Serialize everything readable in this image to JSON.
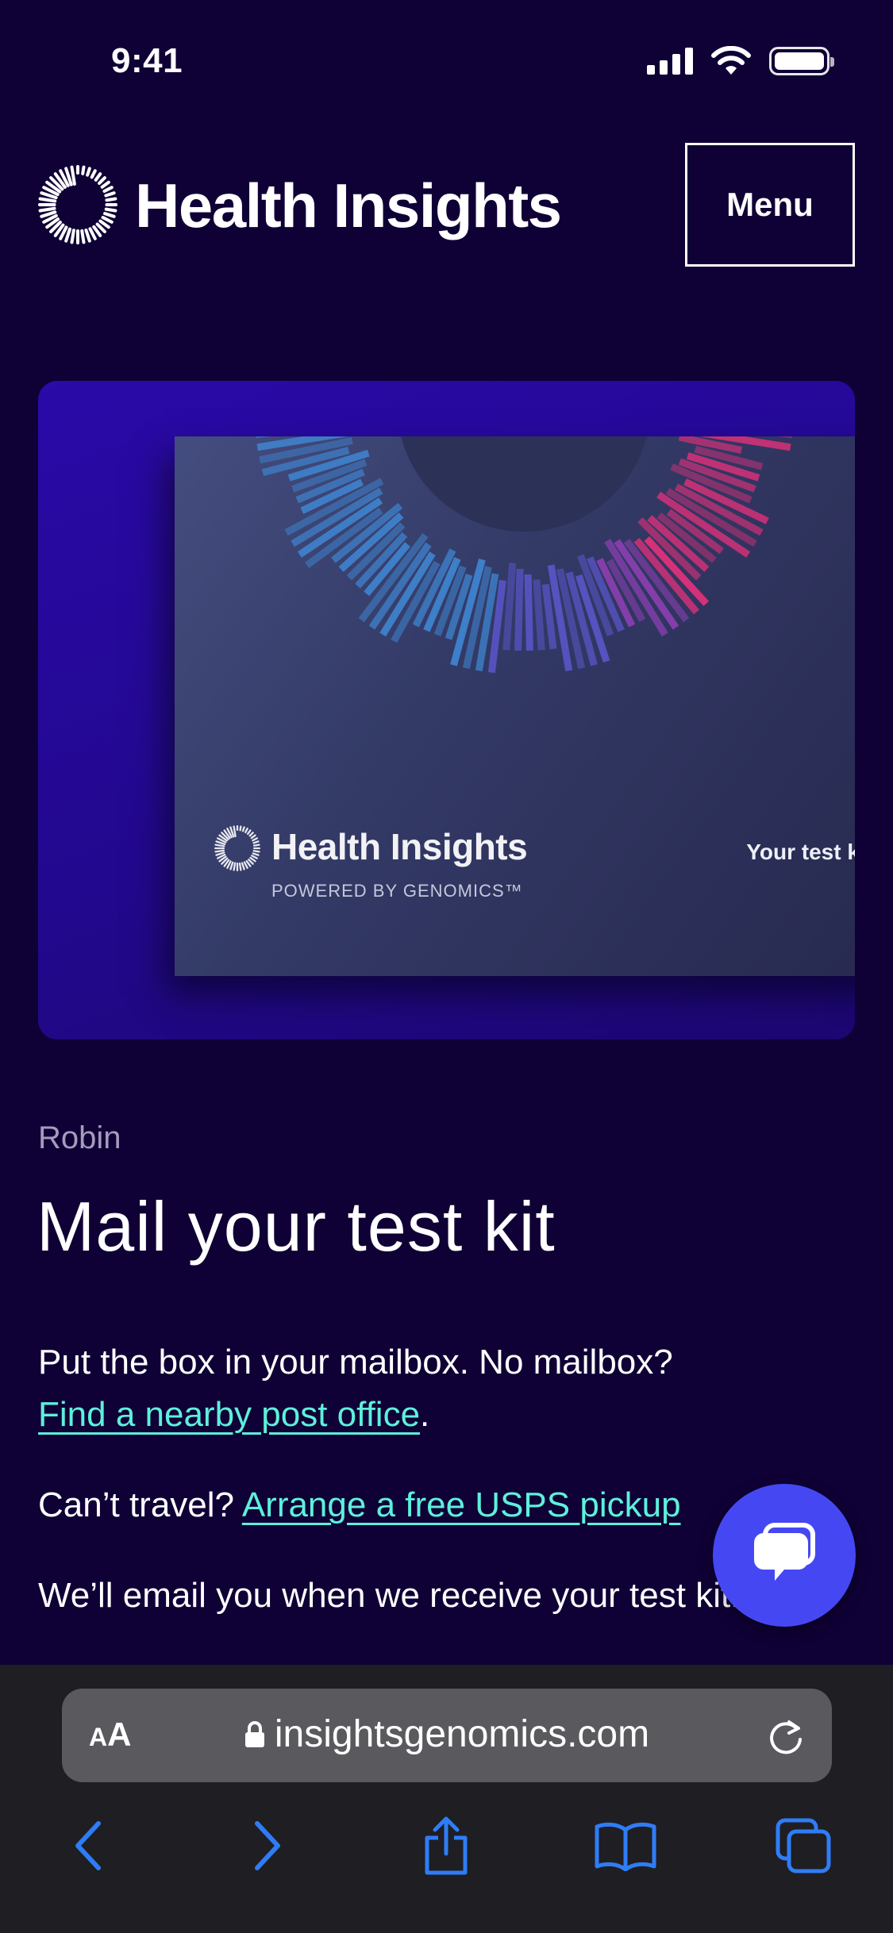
{
  "status_bar": {
    "time": "9:41"
  },
  "header": {
    "brand": "Health Insights",
    "menu_label": "Menu"
  },
  "hero": {
    "kit_brand": "Health Insights",
    "kit_powered": "POWERED BY GENOMICS™",
    "kit_label": "Your test kit"
  },
  "content": {
    "user_name": "Robin",
    "title": "Mail your test kit",
    "p1_text": "Put the box in your mailbox. No mailbox?",
    "p1_link": "Find a nearby post office",
    "p1_end": ".",
    "p2_text": "Can’t travel? ",
    "p2_link": "Arrange a free USPS pickup",
    "p3_text": "We’ll email you when we receive your test kit."
  },
  "browser": {
    "aa_label_small": "A",
    "aa_label_large": "A",
    "url": "insightsgenomics.com"
  },
  "colors": {
    "background": "#0f0035",
    "link": "#5df0dc",
    "chat_button": "#4548f2",
    "browser_accent": "#2f7cf6"
  },
  "icons": [
    "cellular-icon",
    "wifi-icon",
    "battery-icon",
    "logo-icon",
    "chat-icon",
    "lock-icon",
    "reload-icon",
    "back-icon",
    "forward-icon",
    "share-icon",
    "bookmarks-icon",
    "tabs-icon"
  ]
}
